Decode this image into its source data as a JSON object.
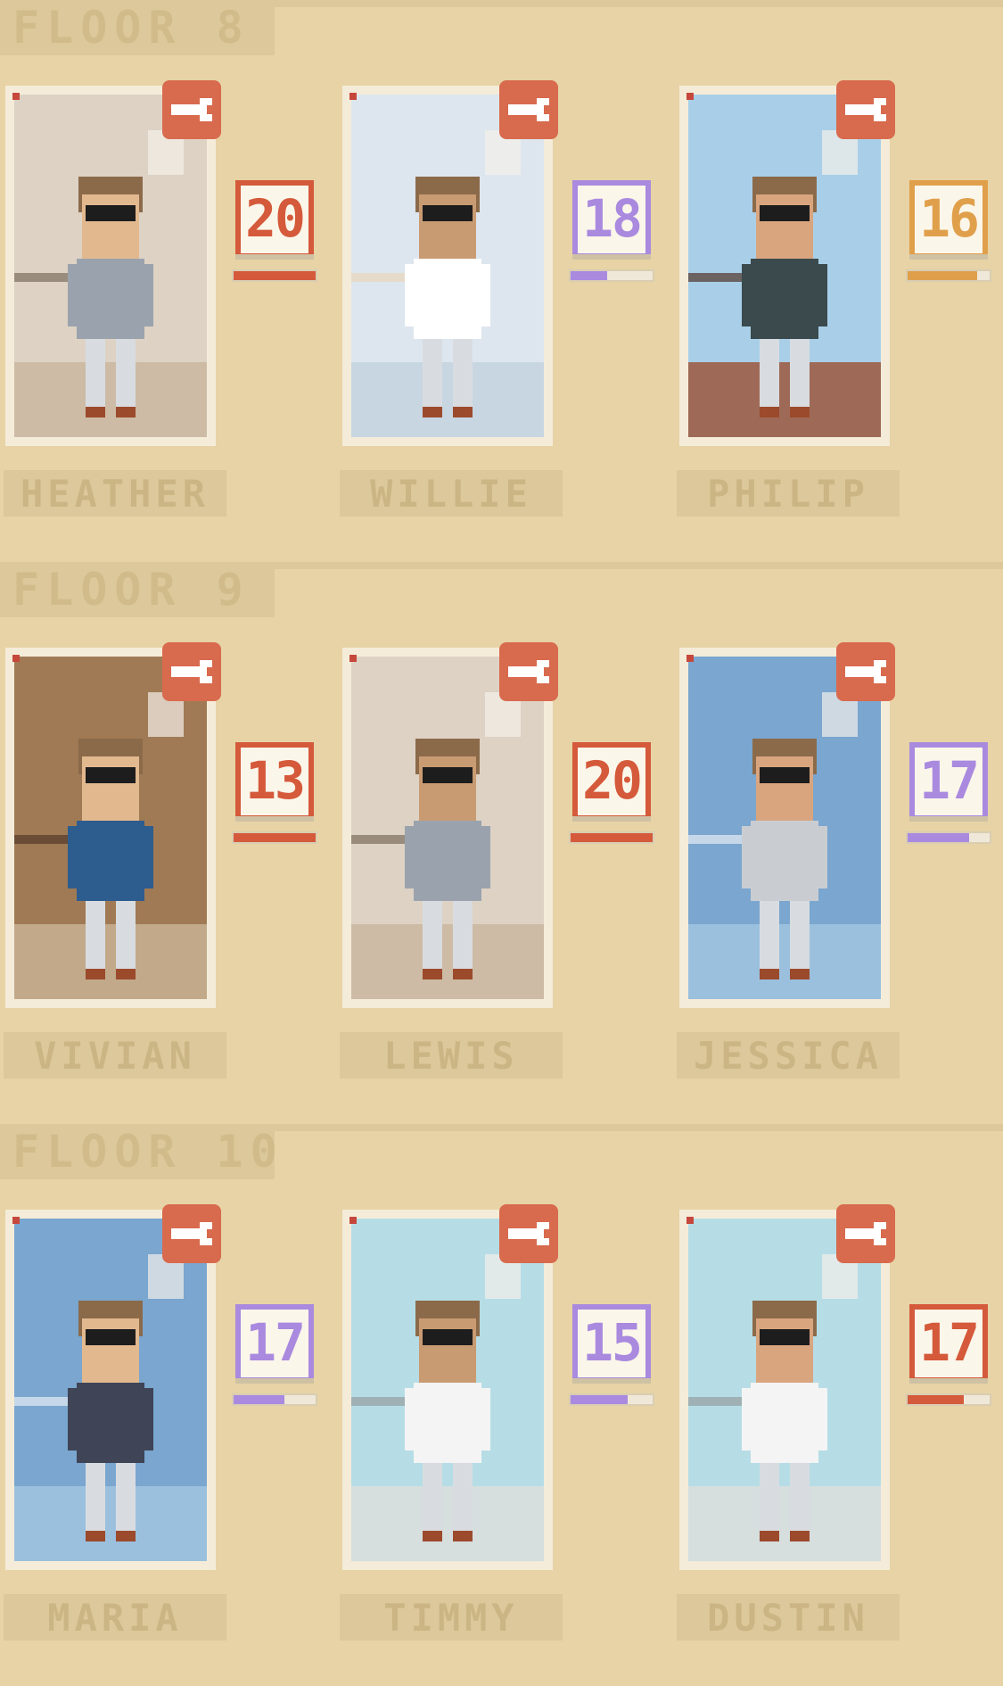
{
  "colors": {
    "background": "#e7d3a5",
    "plate": "#ddc89b",
    "red": "#d45a3b",
    "purple": "#a98adf",
    "orange": "#e0a04b"
  },
  "floors": [
    {
      "title": "FLOOR 8",
      "residents": [
        {
          "name": "HEATHER",
          "level": "20",
          "level_color": "red",
          "progress": 1.0,
          "scene": "office",
          "icon": "wrench-icon"
        },
        {
          "name": "WILLIE",
          "level": "18",
          "level_color": "purple",
          "progress": 0.45,
          "scene": "clinic",
          "icon": "wrench-icon"
        },
        {
          "name": "PHILIP",
          "level": "16",
          "level_color": "orange",
          "progress": 0.85,
          "scene": "garden",
          "icon": "wrench-icon"
        }
      ]
    },
    {
      "title": "FLOOR 9",
      "residents": [
        {
          "name": "VIVIAN",
          "level": "13",
          "level_color": "red",
          "progress": 1.0,
          "scene": "cave",
          "icon": "wrench-icon"
        },
        {
          "name": "LEWIS",
          "level": "20",
          "level_color": "red",
          "progress": 1.0,
          "scene": "office",
          "icon": "wrench-icon"
        },
        {
          "name": "JESSICA",
          "level": "17",
          "level_color": "purple",
          "progress": 0.75,
          "scene": "exam",
          "icon": "wrench-icon"
        }
      ]
    },
    {
      "title": "FLOOR 10",
      "residents": [
        {
          "name": "MARIA",
          "level": "17",
          "level_color": "purple",
          "progress": 0.62,
          "scene": "exam",
          "icon": "wrench-icon"
        },
        {
          "name": "TIMMY",
          "level": "15",
          "level_color": "purple",
          "progress": 0.7,
          "scene": "pilot",
          "icon": "wrench-icon"
        },
        {
          "name": "DUSTIN",
          "level": "17",
          "level_color": "red",
          "progress": 0.68,
          "scene": "pilot",
          "icon": "wrench-icon"
        }
      ]
    }
  ]
}
